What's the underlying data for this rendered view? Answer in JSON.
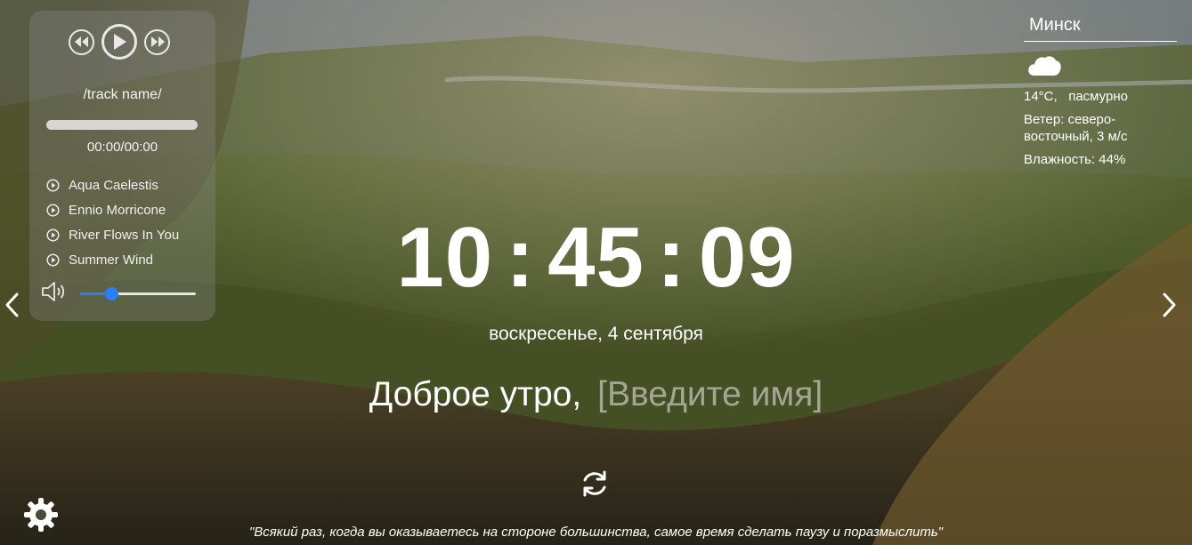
{
  "player": {
    "track_name": "/track name/",
    "time": "00:00/00:00",
    "progress": 0,
    "volume": 0.27,
    "playlist": [
      {
        "title": "Aqua Caelestis"
      },
      {
        "title": "Ennio Morricone"
      },
      {
        "title": "River Flows In You"
      },
      {
        "title": "Summer Wind"
      }
    ]
  },
  "clock": {
    "hours": "10",
    "minutes": "45",
    "seconds": "09",
    "separator": ":"
  },
  "date": "воскресенье, 4 сентября",
  "greeting": {
    "text": "Доброе утро,",
    "name_placeholder": "[Введите имя]"
  },
  "weather": {
    "city": "Минск",
    "icon": "cloud-icon",
    "temperature": "14°C,",
    "description": "пасмурно",
    "wind": "Ветер: северо-восточный, 3 м/с",
    "humidity": "Влажность: 44%"
  },
  "quote": "\"Всякий раз, когда вы оказываетесь на стороне большинства, самое время сделать паузу и поразмыслить\"",
  "colors": {
    "accent": "#2a7fff",
    "text": "#ffffff"
  }
}
